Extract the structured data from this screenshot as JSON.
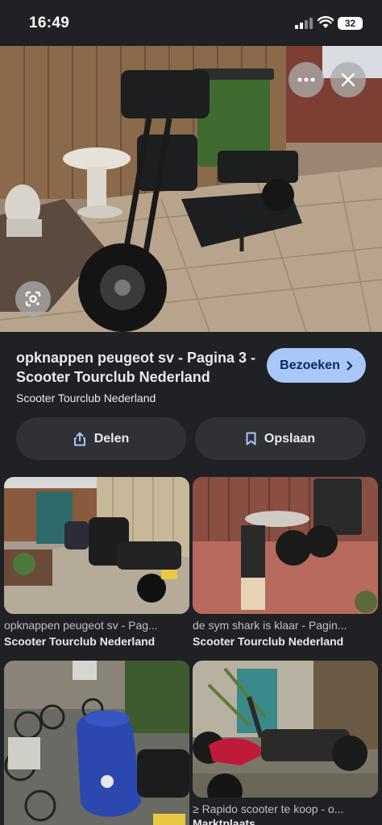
{
  "status": {
    "time": "16:49",
    "battery": "32"
  },
  "result": {
    "title": "opknappen peugeot sv - Pagina 3 - Scooter Tourclub Nederland",
    "source": "Scooter Tourclub Nederland",
    "visit_label": "Bezoeken",
    "share_label": "Delen",
    "save_label": "Opslaan"
  },
  "icons": {
    "more": "more-horizontal-icon",
    "close": "close-icon",
    "lens": "lens-icon",
    "visit": "chevron-right-icon",
    "share": "share-icon",
    "save": "bookmark-icon"
  },
  "grid": [
    {
      "caption": "opknappen peugeot sv - Pag...",
      "source": "Scooter Tourclub Nederland"
    },
    {
      "caption": "de sym shark is klaar - Pagin...",
      "source": "Scooter Tourclub Nederland"
    },
    {
      "caption": "",
      "source": ""
    },
    {
      "caption": "≥ Rapido scooter te koop - o...",
      "source": "Marktplaats"
    }
  ],
  "colors": {
    "background": "#202124",
    "accent": "#a8c7fa",
    "button": "#303134"
  }
}
